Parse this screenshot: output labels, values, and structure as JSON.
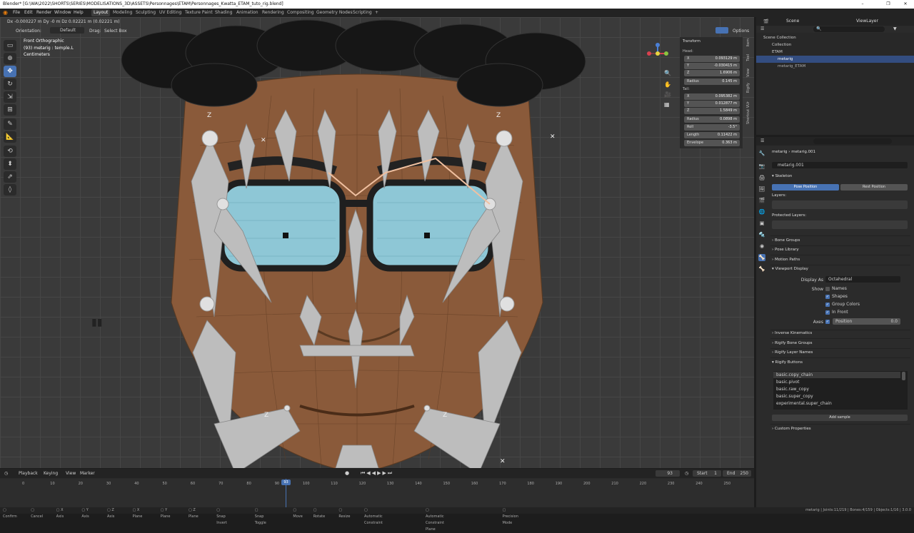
{
  "window": {
    "title": "Blender* [G:\\WA\\2022\\SHORTS\\SERIES\\MODELISATIONS_3D\\ASSETS\\Personnages\\ETAM\\Personnages_Kwatta_ETAM_tuto_rig.blend]",
    "minimize": "–",
    "maximize": "❐",
    "close": "✕"
  },
  "menu": [
    "File",
    "Edit",
    "Render",
    "Window",
    "Help"
  ],
  "workspaces": [
    "Layout",
    "Modeling",
    "Sculpting",
    "UV Editing",
    "Texture Paint",
    "Shading",
    "Animation",
    "Rendering",
    "Compositing",
    "Geometry Nodes",
    "Scripting",
    "+"
  ],
  "viewport": {
    "transform_readout": "Dx -0.000227 m   Dy -0 m   Dz 0.02221 m (0.02221 m)",
    "orientation_label": "Orientation:",
    "orientation_value": "Default",
    "drag_label": "Drag:",
    "drag_value": "Select Box",
    "options": "Options",
    "view_name": "Front Orthographic",
    "view_object": "(93) metarig : temple.L",
    "view_units": "Centimeters"
  },
  "npanel": {
    "header": "Transform",
    "head_label": "Head:",
    "tail_label": "Tail:",
    "head": [
      {
        "k": "X",
        "v": "0.093129 m"
      },
      {
        "k": "Y",
        "v": "-0.030415 m"
      },
      {
        "k": "Z",
        "v": "1.6906 m"
      },
      {
        "k": "Radius",
        "v": "0.145 m"
      }
    ],
    "tail": [
      {
        "k": "X",
        "v": "0.095382 m"
      },
      {
        "k": "Y",
        "v": "0.012877 m"
      },
      {
        "k": "Z",
        "v": "1.5849 m"
      },
      {
        "k": "Radius",
        "v": "0.0898 m"
      },
      {
        "k": "Roll",
        "v": "-3.5°"
      },
      {
        "k": "Length",
        "v": "0.11422 m"
      },
      {
        "k": "Envelope",
        "v": "0.363 m"
      }
    ],
    "tabs": [
      "Item",
      "Tool",
      "View",
      "Rigify",
      "Shortcut VUr"
    ]
  },
  "outliner": {
    "scene": "Scene",
    "view_layer": "ViewLayer",
    "rows": [
      {
        "label": "Scene Collection",
        "indent": 0
      },
      {
        "label": "Collection",
        "indent": 1
      },
      {
        "label": "ETAM",
        "indent": 1
      },
      {
        "label": "metarig",
        "indent": 1
      },
      {
        "label": "metarig_ETAM",
        "indent": 1
      }
    ]
  },
  "properties": {
    "breadcrumb_a": "metarig",
    "breadcrumb_b": "metarig.001",
    "data_name": "metarig.001",
    "skeleton": "Skeleton",
    "pose_position": "Pose Position",
    "rest_position": "Rest Position",
    "layers": "Layers:",
    "protected_layers": "Protected Layers:",
    "bone_groups": "Bone Groups",
    "pose_library": "Pose Library",
    "motion_paths": "Motion Paths",
    "viewport_display": "Viewport Display",
    "display_as_label": "Display As",
    "display_as_value": "Octahedral",
    "show_label": "Show",
    "names": "Names",
    "shapes": "Shapes",
    "group_colors": "Group Colors",
    "in_front": "In Front",
    "axes_label": "Axes",
    "axes_position": "Position",
    "axes_value": "0.0",
    "inverse_kinematics": "Inverse Kinematics",
    "rigify_bone_groups": "Rigify Bone Groups",
    "rigify_layer_names": "Rigify Layer Names",
    "rigify_buttons": "Rigify Buttons",
    "samples": [
      "basic.copy_chain",
      "basic.pivot",
      "basic.raw_copy",
      "basic.super_copy",
      "experimental.super_chain"
    ],
    "add_sample": "Add sample",
    "custom_properties": "Custom Properties"
  },
  "timeline": {
    "playback": "Playback",
    "keying": "Keying",
    "view": "View",
    "marker": "Marker",
    "current_frame": "93",
    "start_label": "Start",
    "start": "1",
    "end_label": "End",
    "end": "250",
    "ticks": [
      "0",
      "10",
      "20",
      "30",
      "40",
      "50",
      "60",
      "70",
      "80",
      "90",
      "100",
      "110",
      "120",
      "130",
      "140",
      "150",
      "160",
      "170",
      "180",
      "190",
      "200",
      "210",
      "220",
      "230",
      "240",
      "250"
    ]
  },
  "status": {
    "items": [
      "Confirm",
      "Cancel",
      "X Axis",
      "Y Axis",
      "Z Axis",
      "X Plane",
      "Y Plane",
      "Z Plane",
      "Snap Invert",
      "Snap Toggle",
      "Move",
      "Rotate",
      "Resize",
      "Automatic Constraint",
      "Automatic Constraint Plane",
      "Precision Mode"
    ],
    "right": "metarig | Joints:11/219 | Bones:4/159 | Objects:1/16 | 3.0.0"
  },
  "colors": {
    "accent": "#4772b3",
    "skin": "#8a5a3a",
    "lens": "#8ec7d6",
    "bone": "#bdbdbd"
  }
}
